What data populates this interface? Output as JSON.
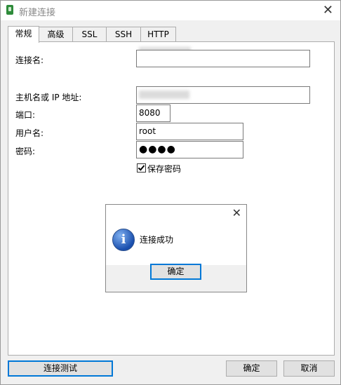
{
  "window": {
    "title": "新建连接"
  },
  "tabs": [
    {
      "label": "常规",
      "active": true
    },
    {
      "label": "高级"
    },
    {
      "label": "SSL"
    },
    {
      "label": "SSH"
    },
    {
      "label": "HTTP"
    }
  ],
  "form": {
    "connection_name_label": "连接名:",
    "host_label": "主机名或 IP 地址:",
    "port_label": "端口:",
    "port_value": "8080",
    "username_label": "用户名:",
    "username_value": "root",
    "password_label": "密码:",
    "password_value": "●●●●",
    "save_password_label": "保存密码",
    "save_password_checked": true
  },
  "dialog": {
    "message": "连接成功",
    "ok_label": "确定",
    "icon": "info-icon"
  },
  "footer": {
    "test_label": "连接测试",
    "ok_label": "确定",
    "cancel_label": "取消"
  },
  "colors": {
    "accent": "#0078d7",
    "panel_bg": "#f0f0f0"
  }
}
